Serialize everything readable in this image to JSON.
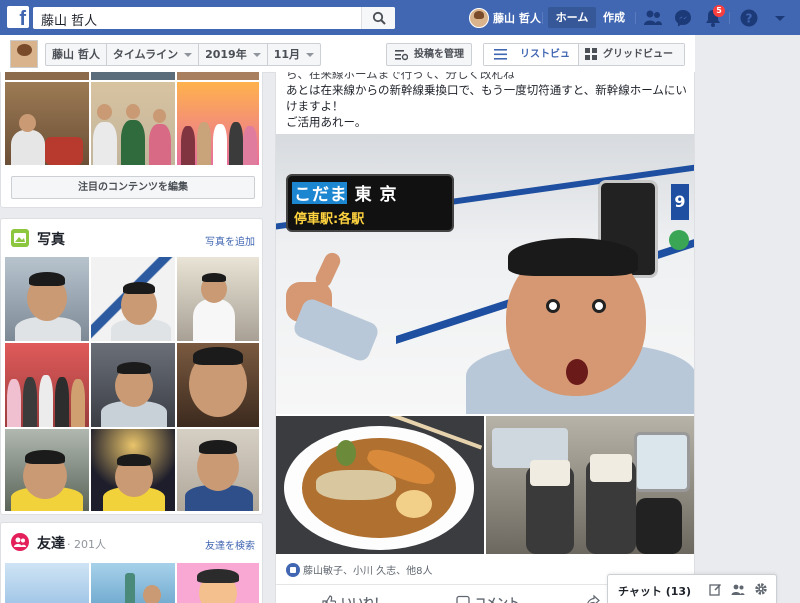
{
  "colors": {
    "brand": "#4267b2",
    "brand_dark": "#365899",
    "badge": "#fa3e3e",
    "link": "#4267b2"
  },
  "topbar": {
    "logo": "f",
    "search_value": "藤山 哲人",
    "search_icon": "search-icon",
    "profile_name": "藤山 哲人",
    "home_label": "ホーム",
    "create_label": "作成",
    "notification_count": "5",
    "icons": [
      "friends-icon",
      "messenger-icon",
      "notifications-icon",
      "help-icon",
      "dropdown-caret-icon"
    ]
  },
  "subbar": {
    "name": "藤山 哲人",
    "timeline_label": "タイムライン",
    "year_label": "2019年",
    "month_label": "11月",
    "manage_label": "投稿を管理",
    "list_view_label": "リストビュー",
    "grid_view_label": "グリッドビュー"
  },
  "featured": {
    "edit_label": "注目のコンテンツを編集"
  },
  "photos": {
    "title": "写真",
    "add_link": "写真を追加"
  },
  "friends": {
    "title": "友達",
    "count": "· 201人",
    "search_link": "友達を検索"
  },
  "post": {
    "text_lines": [
      "ら、在来線ホームまで行って、分しく改札ね",
      "あとは在来線からの新幹線乗換口で、もう一度切符通すと、新幹線ホームにい",
      "けますよ！",
      "ご活用あれー。"
    ],
    "sign_line1": "こだま 東 京",
    "sign_line2": "停車駅:各駅",
    "car_number": "9",
    "reactions": "藤山敏子、小川 久志、他8人",
    "like_label": "いいね！",
    "comment_label": "コメント"
  },
  "chat": {
    "label": "チャット (13)",
    "icons": [
      "compose-icon",
      "group-icon",
      "settings-icon"
    ]
  }
}
